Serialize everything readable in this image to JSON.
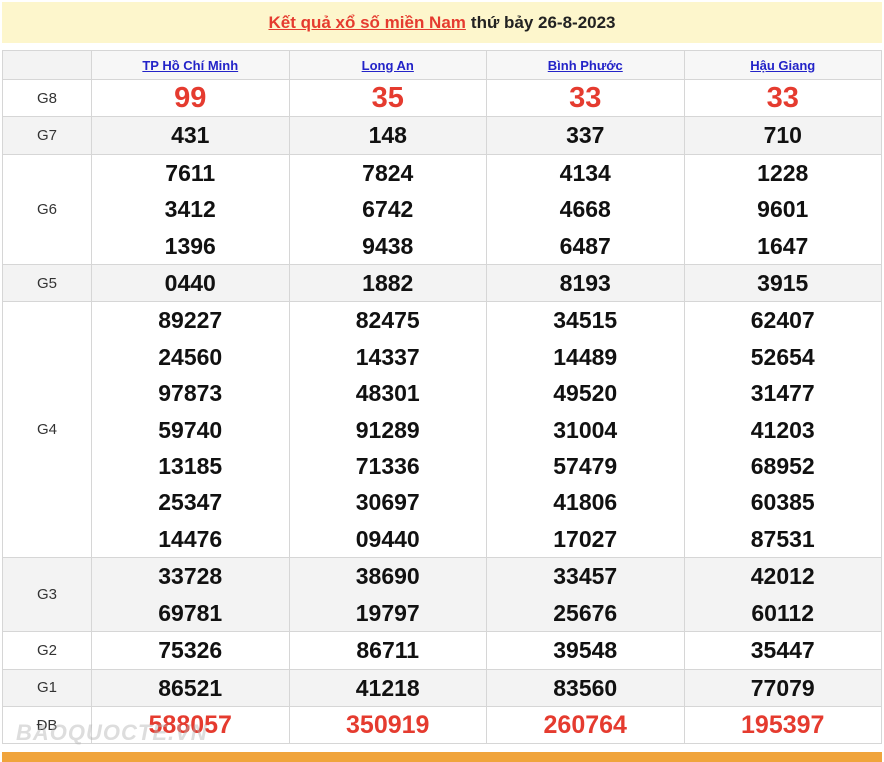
{
  "title": {
    "link_text": "Kết quả xổ số miền Nam",
    "rest_text": "thứ bảy 26-8-2023"
  },
  "provinces": [
    "TP Hồ Chí Minh",
    "Long An",
    "Bình Phước",
    "Hậu Giang"
  ],
  "prizes": [
    {
      "label": "G8",
      "values": [
        [
          "99"
        ],
        [
          "35"
        ],
        [
          "33"
        ],
        [
          "33"
        ]
      ]
    },
    {
      "label": "G7",
      "values": [
        [
          "431"
        ],
        [
          "148"
        ],
        [
          "337"
        ],
        [
          "710"
        ]
      ]
    },
    {
      "label": "G6",
      "values": [
        [
          "7611",
          "3412",
          "1396"
        ],
        [
          "7824",
          "6742",
          "9438"
        ],
        [
          "4134",
          "4668",
          "6487"
        ],
        [
          "1228",
          "9601",
          "1647"
        ]
      ]
    },
    {
      "label": "G5",
      "values": [
        [
          "0440"
        ],
        [
          "1882"
        ],
        [
          "8193"
        ],
        [
          "3915"
        ]
      ]
    },
    {
      "label": "G4",
      "values": [
        [
          "89227",
          "24560",
          "97873",
          "59740",
          "13185",
          "25347",
          "14476"
        ],
        [
          "82475",
          "14337",
          "48301",
          "91289",
          "71336",
          "30697",
          "09440"
        ],
        [
          "34515",
          "14489",
          "49520",
          "31004",
          "57479",
          "41806",
          "17027"
        ],
        [
          "62407",
          "52654",
          "31477",
          "41203",
          "68952",
          "60385",
          "87531"
        ]
      ]
    },
    {
      "label": "G3",
      "values": [
        [
          "33728",
          "69781"
        ],
        [
          "38690",
          "19797"
        ],
        [
          "33457",
          "25676"
        ],
        [
          "42012",
          "60112"
        ]
      ]
    },
    {
      "label": "G2",
      "values": [
        [
          "75326"
        ],
        [
          "86711"
        ],
        [
          "39548"
        ],
        [
          "35447"
        ]
      ]
    },
    {
      "label": "G1",
      "values": [
        [
          "86521"
        ],
        [
          "41218"
        ],
        [
          "83560"
        ],
        [
          "77079"
        ]
      ]
    },
    {
      "label": "ĐB",
      "values": [
        [
          "588057"
        ],
        [
          "350919"
        ],
        [
          "260764"
        ],
        [
          "195397"
        ]
      ]
    }
  ],
  "watermark": "BAOQUOCTE.VN"
}
